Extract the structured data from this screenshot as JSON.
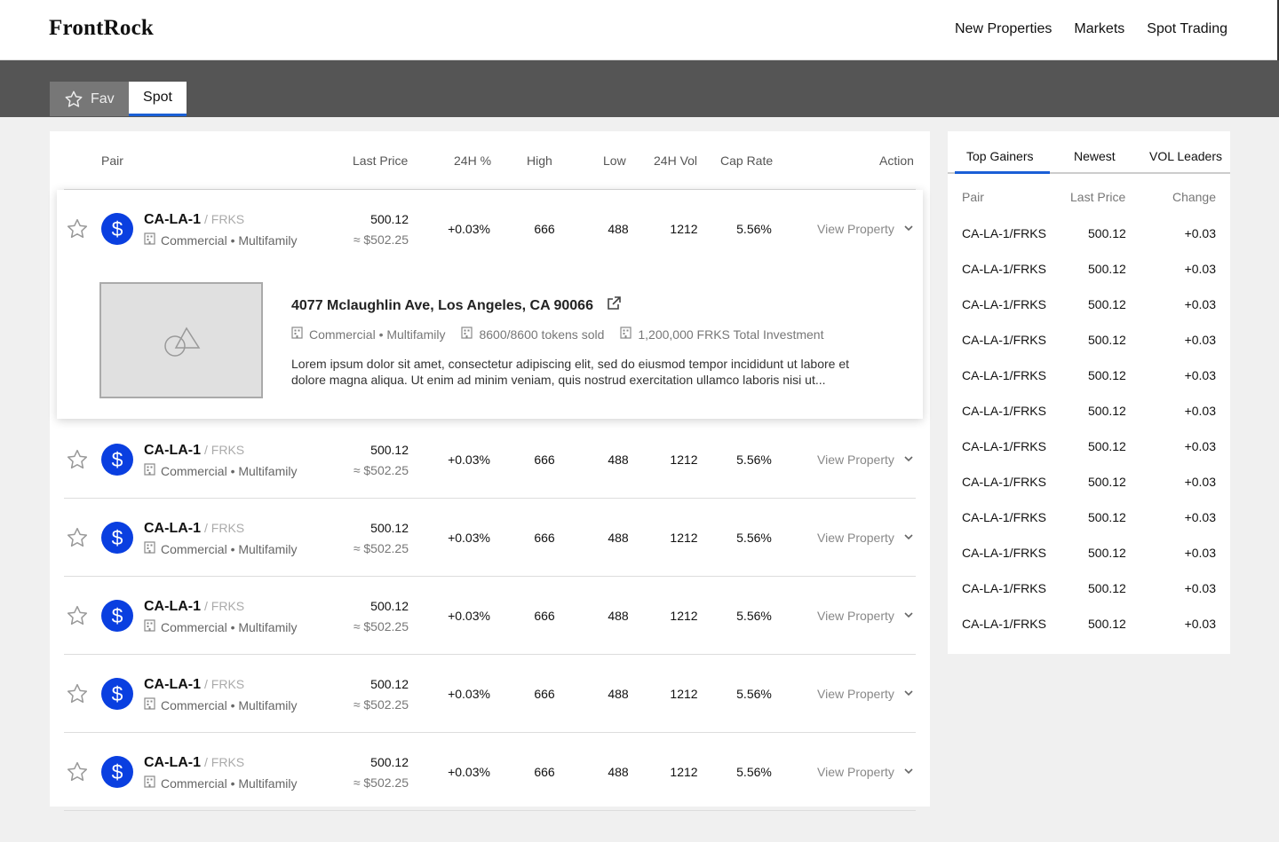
{
  "app": {
    "logo": "FrontRock"
  },
  "nav": [
    "New Properties",
    "Markets",
    "Spot Trading"
  ],
  "tabs": {
    "fav": "Fav",
    "spot": "Spot"
  },
  "table": {
    "headers": {
      "pair": "Pair",
      "last_price": "Last Price",
      "change_24h": "24H %",
      "high": "High",
      "low": "Low",
      "vol_24h": "24H Vol",
      "cap_rate": "Cap Rate",
      "action": "Action"
    },
    "rows": [
      {
        "pair": "CA-LA-1",
        "quote": "/ FRKS",
        "type": "Commercial • Multifamily",
        "price": "500.12",
        "approx": "≈ $502.25",
        "change": "+0.03%",
        "high": "666",
        "low": "488",
        "vol": "1212",
        "cap": "5.56%",
        "action": "View Property"
      },
      {
        "pair": "CA-LA-1",
        "quote": "/ FRKS",
        "type": "Commercial • Multifamily",
        "price": "500.12",
        "approx": "≈ $502.25",
        "change": "+0.03%",
        "high": "666",
        "low": "488",
        "vol": "1212",
        "cap": "5.56%",
        "action": "View Property"
      },
      {
        "pair": "CA-LA-1",
        "quote": "/ FRKS",
        "type": "Commercial • Multifamily",
        "price": "500.12",
        "approx": "≈ $502.25",
        "change": "+0.03%",
        "high": "666",
        "low": "488",
        "vol": "1212",
        "cap": "5.56%",
        "action": "View Property"
      },
      {
        "pair": "CA-LA-1",
        "quote": "/ FRKS",
        "type": "Commercial • Multifamily",
        "price": "500.12",
        "approx": "≈ $502.25",
        "change": "+0.03%",
        "high": "666",
        "low": "488",
        "vol": "1212",
        "cap": "5.56%",
        "action": "View Property"
      },
      {
        "pair": "CA-LA-1",
        "quote": "/ FRKS",
        "type": "Commercial • Multifamily",
        "price": "500.12",
        "approx": "≈ $502.25",
        "change": "+0.03%",
        "high": "666",
        "low": "488",
        "vol": "1212",
        "cap": "5.56%",
        "action": "View Property"
      },
      {
        "pair": "CA-LA-1",
        "quote": "/ FRKS",
        "type": "Commercial • Multifamily",
        "price": "500.12",
        "approx": "≈ $502.25",
        "change": "+0.03%",
        "high": "666",
        "low": "488",
        "vol": "1212",
        "cap": "5.56%",
        "action": "View Property"
      }
    ],
    "expanded": {
      "address": "4077 Mclaughlin Ave, Los Angeles, CA 90066",
      "type": "Commercial • Multifamily",
      "tokens": "8600/8600 tokens sold",
      "investment": "1,200,000 FRKS Total Investment",
      "description": "Lorem ipsum dolor sit amet, consectetur adipiscing elit, sed do eiusmod tempor incididunt ut labore et dolore magna aliqua. Ut enim ad minim veniam, quis nostrud exercitation ullamco laboris nisi ut..."
    }
  },
  "side": {
    "tabs": [
      "Top Gainers",
      "Newest",
      "VOL Leaders"
    ],
    "active_tab": "Top Gainers",
    "headers": {
      "pair": "Pair",
      "last_price": "Last Price",
      "change": "Change"
    },
    "rows": [
      {
        "pair": "CA-LA-1/FRKS",
        "price": "500.12",
        "change": "+0.03"
      },
      {
        "pair": "CA-LA-1/FRKS",
        "price": "500.12",
        "change": "+0.03"
      },
      {
        "pair": "CA-LA-1/FRKS",
        "price": "500.12",
        "change": "+0.03"
      },
      {
        "pair": "CA-LA-1/FRKS",
        "price": "500.12",
        "change": "+0.03"
      },
      {
        "pair": "CA-LA-1/FRKS",
        "price": "500.12",
        "change": "+0.03"
      },
      {
        "pair": "CA-LA-1/FRKS",
        "price": "500.12",
        "change": "+0.03"
      },
      {
        "pair": "CA-LA-1/FRKS",
        "price": "500.12",
        "change": "+0.03"
      },
      {
        "pair": "CA-LA-1/FRKS",
        "price": "500.12",
        "change": "+0.03"
      },
      {
        "pair": "CA-LA-1/FRKS",
        "price": "500.12",
        "change": "+0.03"
      },
      {
        "pair": "CA-LA-1/FRKS",
        "price": "500.12",
        "change": "+0.03"
      },
      {
        "pair": "CA-LA-1/FRKS",
        "price": "500.12",
        "change": "+0.03"
      },
      {
        "pair": "CA-LA-1/FRKS",
        "price": "500.12",
        "change": "+0.03"
      }
    ]
  },
  "colors": {
    "accent": "#1a5fd6",
    "coin": "#0a3fe0",
    "dark_bar": "#555555"
  },
  "icons": {
    "star": "star-icon",
    "coin": "dollar-coin-icon",
    "building": "building-icon",
    "chevron": "chevron-down-icon",
    "external": "external-link-icon",
    "image": "image-placeholder-icon"
  }
}
